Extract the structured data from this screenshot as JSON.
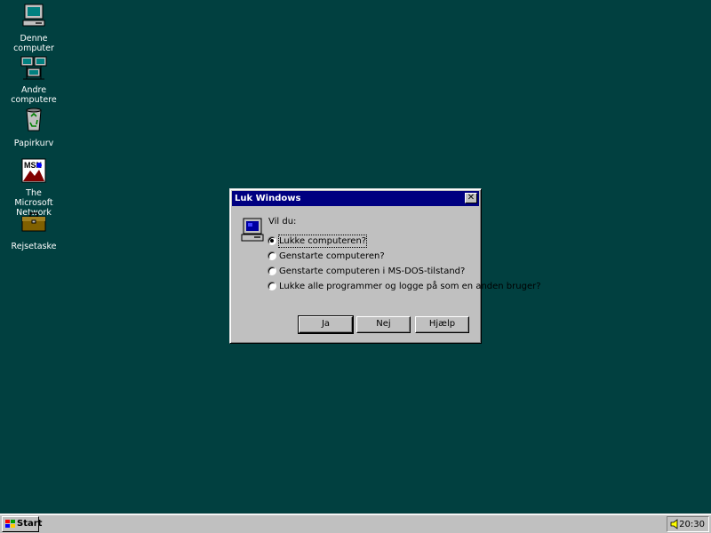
{
  "desktop": {
    "icons": [
      {
        "label": "Denne computer",
        "icon": "my-computer-icon"
      },
      {
        "label": "Andre computere",
        "icon": "network-neighborhood-icon"
      },
      {
        "label": "Papirkurv",
        "icon": "recycle-bin-icon"
      },
      {
        "label": "The Microsoft Network",
        "icon": "msn-icon"
      },
      {
        "label": "Rejsetaske",
        "icon": "briefcase-icon"
      }
    ],
    "background_color": "#014040"
  },
  "dialog": {
    "title": "Luk Windows",
    "close_glyph": "✕",
    "prompt": "Vil du:",
    "options": [
      {
        "label": "Lukke computeren?",
        "selected": true
      },
      {
        "label": "Genstarte computeren?",
        "selected": false
      },
      {
        "label": "Genstarte computeren i MS-DOS-tilstand?",
        "selected": false
      },
      {
        "label": "Lukke alle programmer og logge på som en anden bruger?",
        "selected": false
      }
    ],
    "buttons": {
      "yes": "Ja",
      "no": "Nej",
      "help": "Hjælp"
    },
    "title_bar_color": "#000080"
  },
  "taskbar": {
    "start_label": "Start",
    "clock": "20:30",
    "tray_icon": "speaker-icon"
  }
}
